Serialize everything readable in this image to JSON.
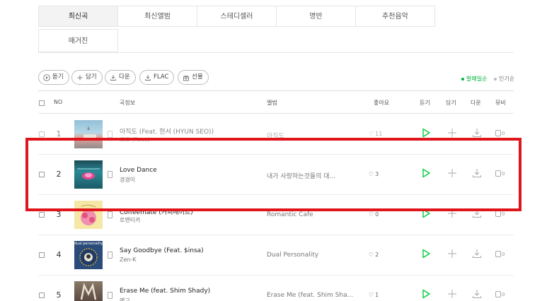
{
  "tabs": [
    {
      "label": "최신곡",
      "active": true
    },
    {
      "label": "최신앨범",
      "active": false
    },
    {
      "label": "스테디셀러",
      "active": false
    },
    {
      "label": "명반",
      "active": false
    },
    {
      "label": "추천음악",
      "active": false
    },
    {
      "label": "매거진",
      "active": false
    }
  ],
  "actions": {
    "listen": "듣기",
    "add": "담기",
    "download": "다운",
    "flac": "FLAC",
    "gift": "선물"
  },
  "sort": {
    "release": "발매일순",
    "popular": "인기순"
  },
  "header": {
    "no": "NO",
    "song": "곡정보",
    "album": "앨범",
    "like": "좋아요",
    "listen": "듣기",
    "add": "담기",
    "download": "다운",
    "mv": "뮤비"
  },
  "songs": [
    {
      "no": "1",
      "title": "아직도 (Feat. 현서 (HYUN SEO))",
      "artist": "로코 (Roco)",
      "album": "아직도",
      "likes": "11",
      "mv": "0"
    },
    {
      "no": "2",
      "title": "Love Dance",
      "artist": "경경이",
      "album": "내가 사랑하는것들의 대...",
      "likes": "3",
      "mv": "0"
    },
    {
      "no": "3",
      "title": "Coffeemate (커피메이트)",
      "artist": "로맨티카",
      "album": "Romantic Cafe",
      "likes": "0",
      "mv": "0"
    },
    {
      "no": "4",
      "title": "Say Goodbye (Feat. $insa)",
      "artist": "Zen-K",
      "album": "Dual Personality",
      "likes": "2",
      "mv": "0"
    },
    {
      "no": "5",
      "title": "Erase Me (feat. Shim Shady)",
      "artist": "맨고",
      "album": "Erase Me (feat. Shim Sha...",
      "likes": "1",
      "mv": "0"
    }
  ],
  "art_captions": {
    "row4": "dual personality"
  },
  "colors": {
    "accent_green": "#00cd3c",
    "highlight_red": "#e0151c"
  }
}
